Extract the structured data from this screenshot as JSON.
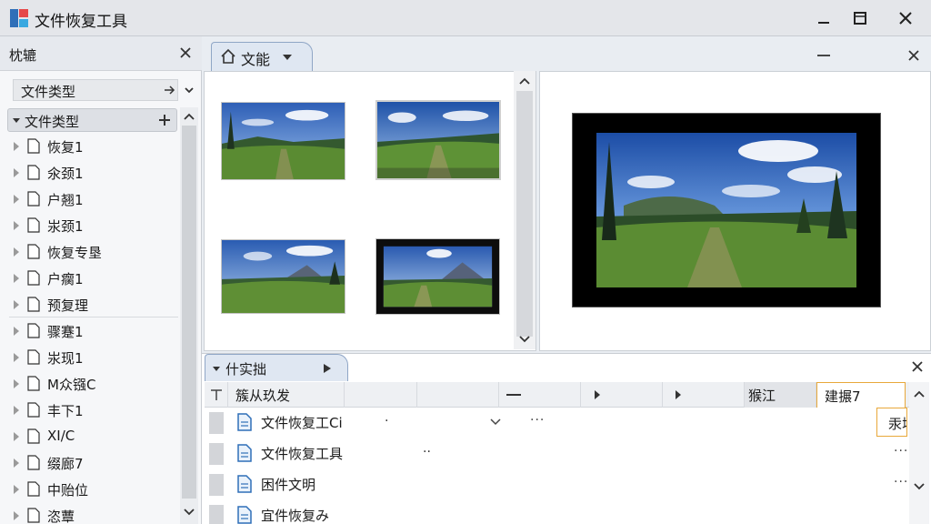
{
  "window": {
    "title": "文件恢复工具"
  },
  "left_panel": {
    "title": "枕辘",
    "combo_label": "文件类型",
    "tree_header": "文件类型",
    "items": [
      {
        "label": "恢复1"
      },
      {
        "label": "氽颈1"
      },
      {
        "label": "户翘1"
      },
      {
        "label": "汖颈1"
      },
      {
        "label": "恢复专垦"
      },
      {
        "label": "户瘸1"
      },
      {
        "label": "预复理"
      },
      {
        "label": "骤蹇1"
      },
      {
        "label": "汖现1"
      },
      {
        "label": "M众镪C"
      },
      {
        "label": "丰下1"
      },
      {
        "label": "XI/C"
      },
      {
        "label": "缀廊7"
      },
      {
        "label": "中贻位"
      },
      {
        "label": "恣蕈"
      }
    ]
  },
  "document_tab": {
    "label": "文能"
  },
  "bottom_panel": {
    "tab_label": "什实拙",
    "columns": {
      "name": "簇从玖发",
      "col_a": "猴江",
      "col_b": "建搌7",
      "popup": "汞增"
    },
    "rows": [
      {
        "name": "文件恢复工Ci",
        "mark": "·"
      },
      {
        "name": "文件恢复工具",
        "mark": "··"
      },
      {
        "name": "困件文明",
        "mark": ""
      },
      {
        "name": "宜件恢复み",
        "mark": ""
      }
    ],
    "more_glyph": "···"
  },
  "colors": {
    "accent": "#8fa6c6",
    "highlight": "#e8a83a",
    "doc_icon": "#2f6fb8"
  }
}
